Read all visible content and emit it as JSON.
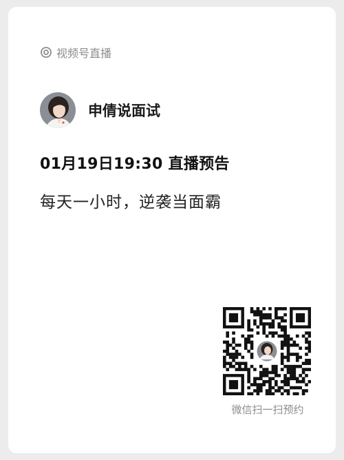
{
  "channel": {
    "icon": "live-ring-icon",
    "label": "视频号直播"
  },
  "profile": {
    "name": "申倩说面试"
  },
  "event": {
    "title": "01月19日19:30 直播预告",
    "subtitle": "每天一小时，逆袭当面霸"
  },
  "qr": {
    "caption": "微信扫一扫预约"
  }
}
